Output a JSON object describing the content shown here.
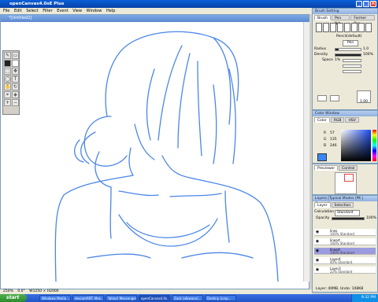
{
  "app": {
    "title": "openCanvas4.0sE Plus"
  },
  "menu": [
    "File",
    "Edit",
    "Select",
    "Filter",
    "Event",
    "View",
    "Window",
    "Help"
  ],
  "document": {
    "title": "*[Untitled2]"
  },
  "status": {
    "zoom": "250%",
    "angle": "0.0°",
    "size": "W1250 × H2000"
  },
  "brush_panel": {
    "title": "Brush Setting",
    "tabs": [
      "Brush",
      "Pen Nib",
      "Former Pen"
    ],
    "preset": "Pencil(default)",
    "mode": "Pen",
    "radius_label": "Radius",
    "radius_value": "1.0",
    "density_label": "Density",
    "density_value": "100%",
    "spacing_label": "Space",
    "spacing_value": "1%",
    "preview_value": "1.00",
    "radius_fill": 0.12,
    "density_fill": 1.0
  },
  "color_panel": {
    "title": "Color Window",
    "tabs": [
      "Color",
      "RGB",
      "HSV"
    ],
    "r_label": "R",
    "r": "57",
    "g_label": "G",
    "g": "135",
    "b_label": "B",
    "b": "246",
    "current_color": "#3987f6"
  },
  "preview_panel": {
    "tabs": [
      "Previewer",
      "Control"
    ]
  },
  "layer_panel": {
    "title": "Layers [Typical Modes (PK | Sketch)]",
    "tabs": [
      "Layer",
      "Selection"
    ],
    "calc_label": "Calculation",
    "calc_value": "Standard",
    "opacity_label": "Opacity",
    "opacity_value": "100%",
    "layers": [
      {
        "name": "lines",
        "mode": "100% Standard",
        "selected": false
      },
      {
        "name": "lineart",
        "mode": "100% Standard",
        "selected": false
      },
      {
        "name": "lineart",
        "mode": "100% Standard",
        "selected": true
      },
      {
        "name": "Layer4",
        "mode": "40% Standard",
        "selected": false
      },
      {
        "name": "Layer3",
        "mode": "22% Standard",
        "selected": false
      }
    ],
    "footer": "Layer: 40MB, Undo: 108KB"
  },
  "taskbar": {
    "start": "start",
    "tasks": [
      "Windows Media ...",
      "deviantART: Mes...",
      "Yahoo! Messenger",
      "openCanvas4.0s...",
      "Zack (alkwoon)...",
      "Destiny (ursp..."
    ],
    "clock": "9:32 PM"
  }
}
